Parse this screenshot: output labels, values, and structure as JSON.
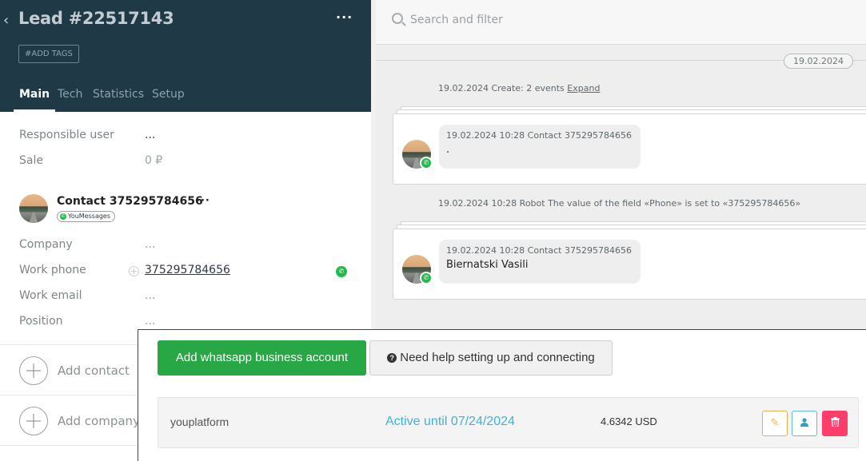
{
  "lead": {
    "title": "Lead #22517143",
    "add_tags": "#ADD TAGS",
    "more": "···",
    "tabs": [
      "Main",
      "Tech",
      "Statistics",
      "Setup"
    ]
  },
  "fields": {
    "responsible_user_label": "Responsible user",
    "responsible_user_value": "...",
    "sale_label": "Sale",
    "sale_value": "0 ₽"
  },
  "contact": {
    "name": "Contact 375295784656",
    "more": "···",
    "channel": "YouMessages",
    "company_label": "Company",
    "company_value": "...",
    "work_phone_label": "Work phone",
    "work_phone_value": "375295784656",
    "work_email_label": "Work email",
    "work_email_value": "...",
    "position_label": "Position",
    "position_value": "..."
  },
  "actions": {
    "add_contact": "Add contact",
    "add_company": "Add company"
  },
  "feed": {
    "search_placeholder": "Search and filter",
    "date": "19.02.2024",
    "create_note": "19.02.2024 Create: 2 events",
    "expand": "Expand",
    "message1_meta": "19.02.2024 10:28 Contact 375295784656",
    "message1_text": ".",
    "robot_note": "19.02.2024 10:28 Robot The value of the field «Phone» is set to «375295784656»",
    "message2_meta": "19.02.2024 10:28 Contact 375295784656",
    "message2_text": "Biernatski Vasili"
  },
  "overlay": {
    "add_button": "Add whatsapp business account",
    "help_button": "Need help setting up and connecting",
    "account_name": "youplatform",
    "account_status": "Active until 07/24/2024",
    "account_balance": "4.6342 USD"
  },
  "colors": {
    "header_bg": "#1f3a46",
    "whatsapp_green": "#25b94b",
    "button_green": "#28a745",
    "status_blue": "#3fb3d6",
    "delete_red": "#ff3d6b"
  },
  "icons": [
    "back-chevron-icon",
    "search-icon",
    "whatsapp-icon",
    "plus-icon",
    "question-icon",
    "pencil-icon",
    "user-icon",
    "trash-icon"
  ]
}
